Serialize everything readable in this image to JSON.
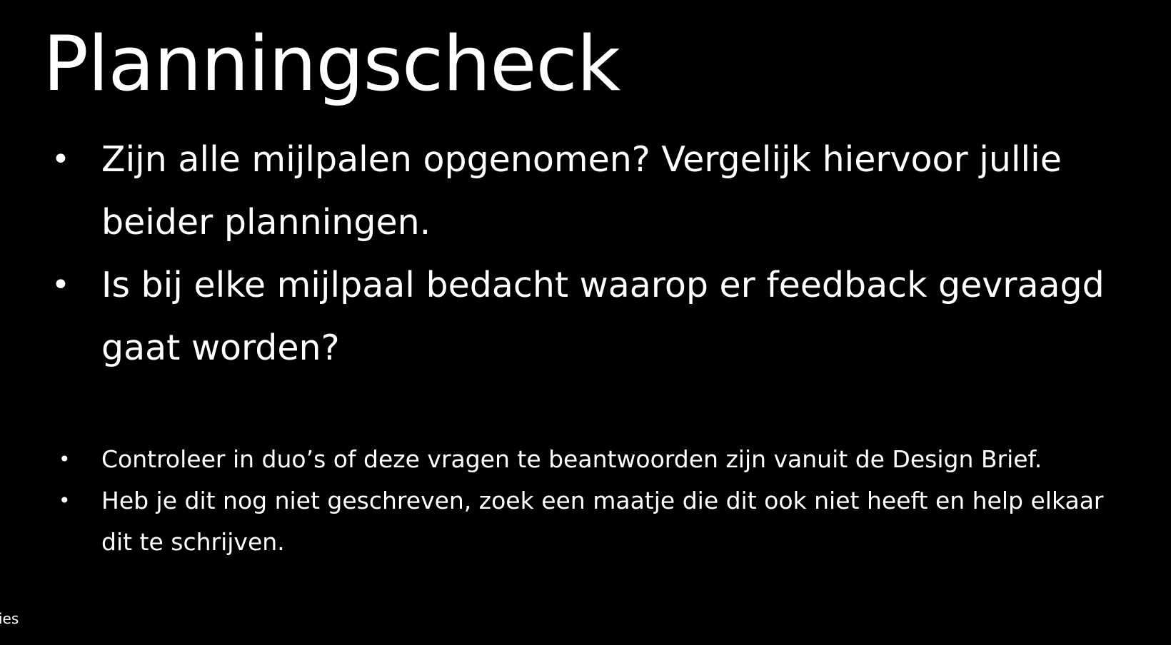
{
  "slide": {
    "title": "Planningscheck",
    "main_bullets": [
      {
        "marker": "•",
        "text": "Zijn alle mijlpalen opgenomen? Vergelijk hiervoor jullie beider planningen."
      },
      {
        "marker": "•",
        "text": "Is bij elke mijlpaal bedacht waarop er feedback gevraagd gaat worden?"
      }
    ],
    "sub_bullets": [
      {
        "marker": "•",
        "text": "Controleer in duo’s of deze vragen te beantwoorden zijn vanuit de Design Brief."
      },
      {
        "marker": "•",
        "text": "Heb je dit nog niet geschreven, zoek een maatje die dit ook niet heeft en help elkaar dit te schrijven."
      }
    ],
    "footer_fragment": "ies"
  },
  "colors": {
    "background": "#000000",
    "text": "#ffffff"
  }
}
